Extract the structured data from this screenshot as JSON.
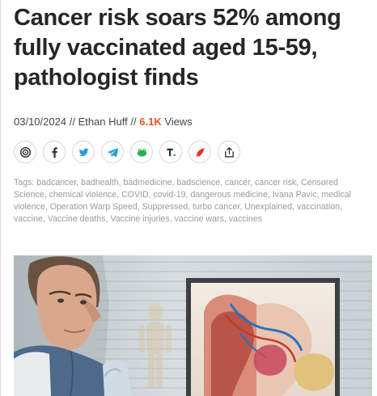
{
  "article": {
    "title": "Cancer risk soars 52% among fully vaccinated aged 15-59, pathologist finds",
    "date": "03/10/2024",
    "author": "Ethan Huff",
    "views_count": "6.1K",
    "views_label": "Views",
    "separator": "//"
  },
  "share_buttons": [
    {
      "name": "brighteon-share-button",
      "icon": "brighteon-icon"
    },
    {
      "name": "facebook-share-button",
      "icon": "facebook-icon"
    },
    {
      "name": "twitter-share-button",
      "icon": "twitter-icon"
    },
    {
      "name": "telegram-share-button",
      "icon": "telegram-icon"
    },
    {
      "name": "gab-share-button",
      "icon": "gab-frog-icon"
    },
    {
      "name": "truth-social-share-button",
      "icon": "truth-social-icon"
    },
    {
      "name": "gettr-share-button",
      "icon": "gettr-icon"
    },
    {
      "name": "native-share-button",
      "icon": "share-icon"
    }
  ],
  "tags": {
    "label": "Tags:",
    "list": "badcancer, badhealth, badmedicine, badscience, cancer, cancer risk, Censored Science, chemical violence, COVID, covid-19, dangerous medicine, Ivana Pavic, medical violence, Operation Warp Speed, Suppressed, turbo cancer, Unexplained, vaccination, vaccine, Vaccine deaths, Vaccine injuries, vaccine wars, vaccines"
  },
  "colors": {
    "views_accent": "#e05a28",
    "title_text": "#262626",
    "tags_text": "#9a9a9a",
    "icon_gray": "#3a3a3a",
    "icon_blue": "#2a9fd8",
    "icon_green": "#25b14c",
    "icon_red": "#e8302a"
  },
  "hero_image": {
    "description_icon": "doctor-viewing-anatomy-chart-photo"
  }
}
